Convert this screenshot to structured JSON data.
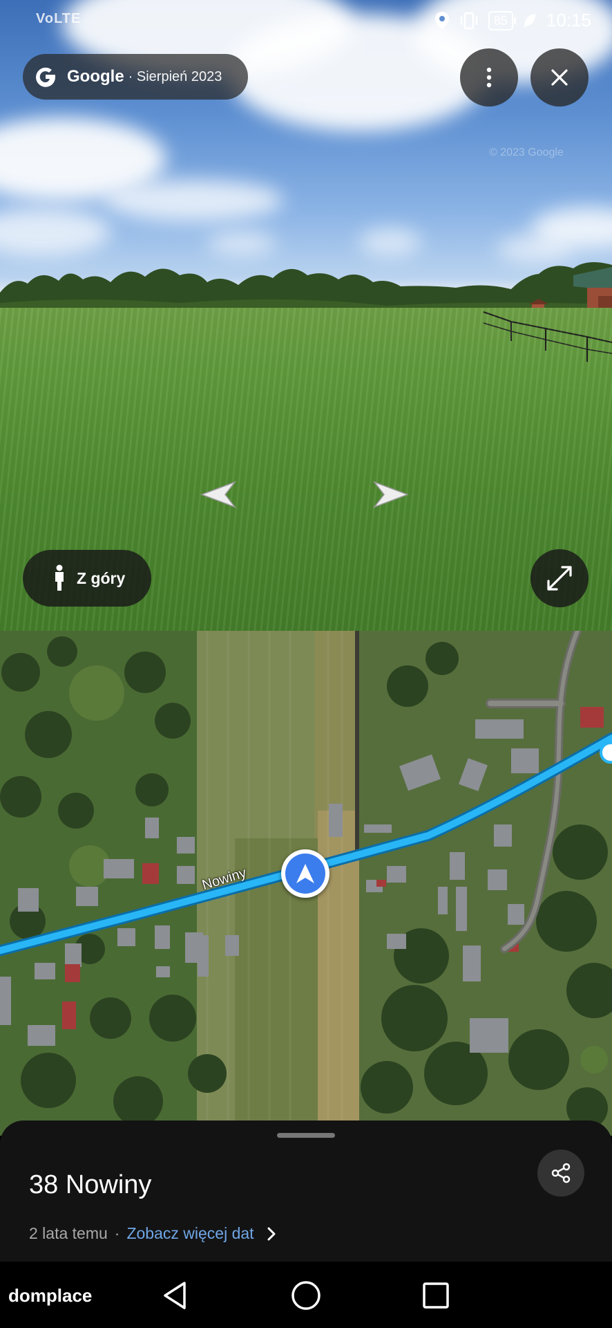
{
  "status_bar": {
    "left_text": "VoLTE",
    "battery": "85",
    "time": "10:15"
  },
  "viewer": {
    "brand": "Google",
    "date": "· Sierpień 2023",
    "watermark": "© 2023 Google",
    "top_down_label": "Z góry"
  },
  "map": {
    "street_label": "Nowiny"
  },
  "sheet": {
    "title": "38 Nowiny",
    "age": "2 lata temu",
    "separator": "·",
    "more_dates": "Zobacz więcej dat"
  },
  "nav_bar": {
    "brand": "domplace"
  },
  "colors": {
    "accent": "#3b7ded",
    "link": "#6fa6e6",
    "road_highlight": "#29b6f6"
  },
  "icons": [
    "google-g-icon",
    "more-vert-icon",
    "close-icon",
    "chevron-left-icon",
    "chevron-right-icon",
    "pegman-icon",
    "expand-icon",
    "navigation-arrow-icon",
    "share-icon",
    "chevron-right-small-icon",
    "back-icon",
    "home-icon",
    "recents-icon"
  ]
}
